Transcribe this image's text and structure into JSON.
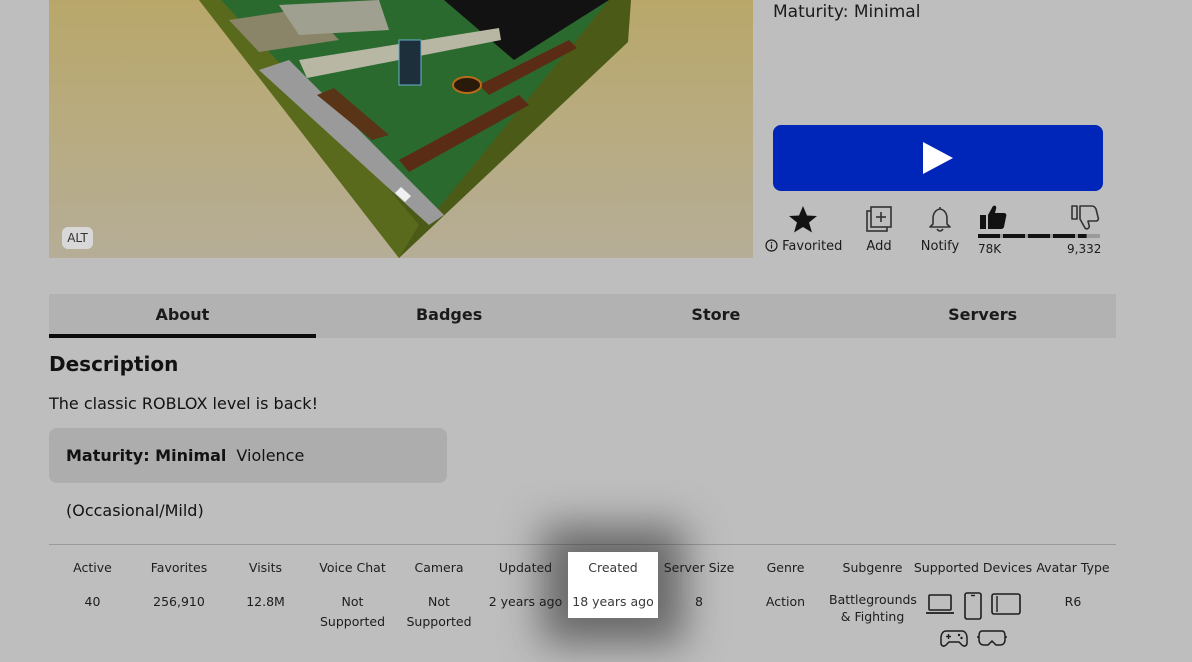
{
  "thumbnail": {
    "alt_badge": "ALT"
  },
  "right_panel": {
    "maturity_text": "Maturity: Minimal",
    "actions": [
      {
        "label": "Favorited",
        "icon": "star-icon",
        "info_icon": "info-icon"
      },
      {
        "label": "Add",
        "icon": "add-to-collection-icon"
      },
      {
        "label": "Notify",
        "icon": "bell-icon"
      }
    ],
    "votes": {
      "up": "78K",
      "down": "9,332",
      "up_fraction": 0.89
    }
  },
  "tabs": [
    {
      "label": "About",
      "active": true
    },
    {
      "label": "Badges",
      "active": false
    },
    {
      "label": "Store",
      "active": false
    },
    {
      "label": "Servers",
      "active": false
    }
  ],
  "description": {
    "title": "Description",
    "text": "The classic ROBLOX level is back!",
    "maturity_label": "Maturity: Minimal",
    "maturity_value": "Violence (Occasional/Mild)"
  },
  "stats": [
    {
      "label": "Active",
      "value": "40"
    },
    {
      "label": "Favorites",
      "value": "256,910"
    },
    {
      "label": "Visits",
      "value": "12.8M"
    },
    {
      "label": "Voice Chat",
      "value": "Not Supported"
    },
    {
      "label": "Camera",
      "value": "Not Supported"
    },
    {
      "label": "Updated",
      "value": "2 years ago"
    },
    {
      "label": "Created",
      "value": "18 years ago"
    },
    {
      "label": "Server Size",
      "value": "8"
    },
    {
      "label": "Genre",
      "value": "Action"
    },
    {
      "label": "Subgenre",
      "value": "Battlegrounds & Fighting"
    },
    {
      "label": "Supported Devices",
      "devices": [
        "computer-icon",
        "phone-icon",
        "tablet-icon",
        "console-icon",
        "vr-headset-icon"
      ]
    },
    {
      "label": "Avatar Type",
      "value": "R6"
    }
  ],
  "colors": {
    "play_button": "#0025b9",
    "page_background": "#bebebe",
    "highlight": "#ffffff"
  }
}
